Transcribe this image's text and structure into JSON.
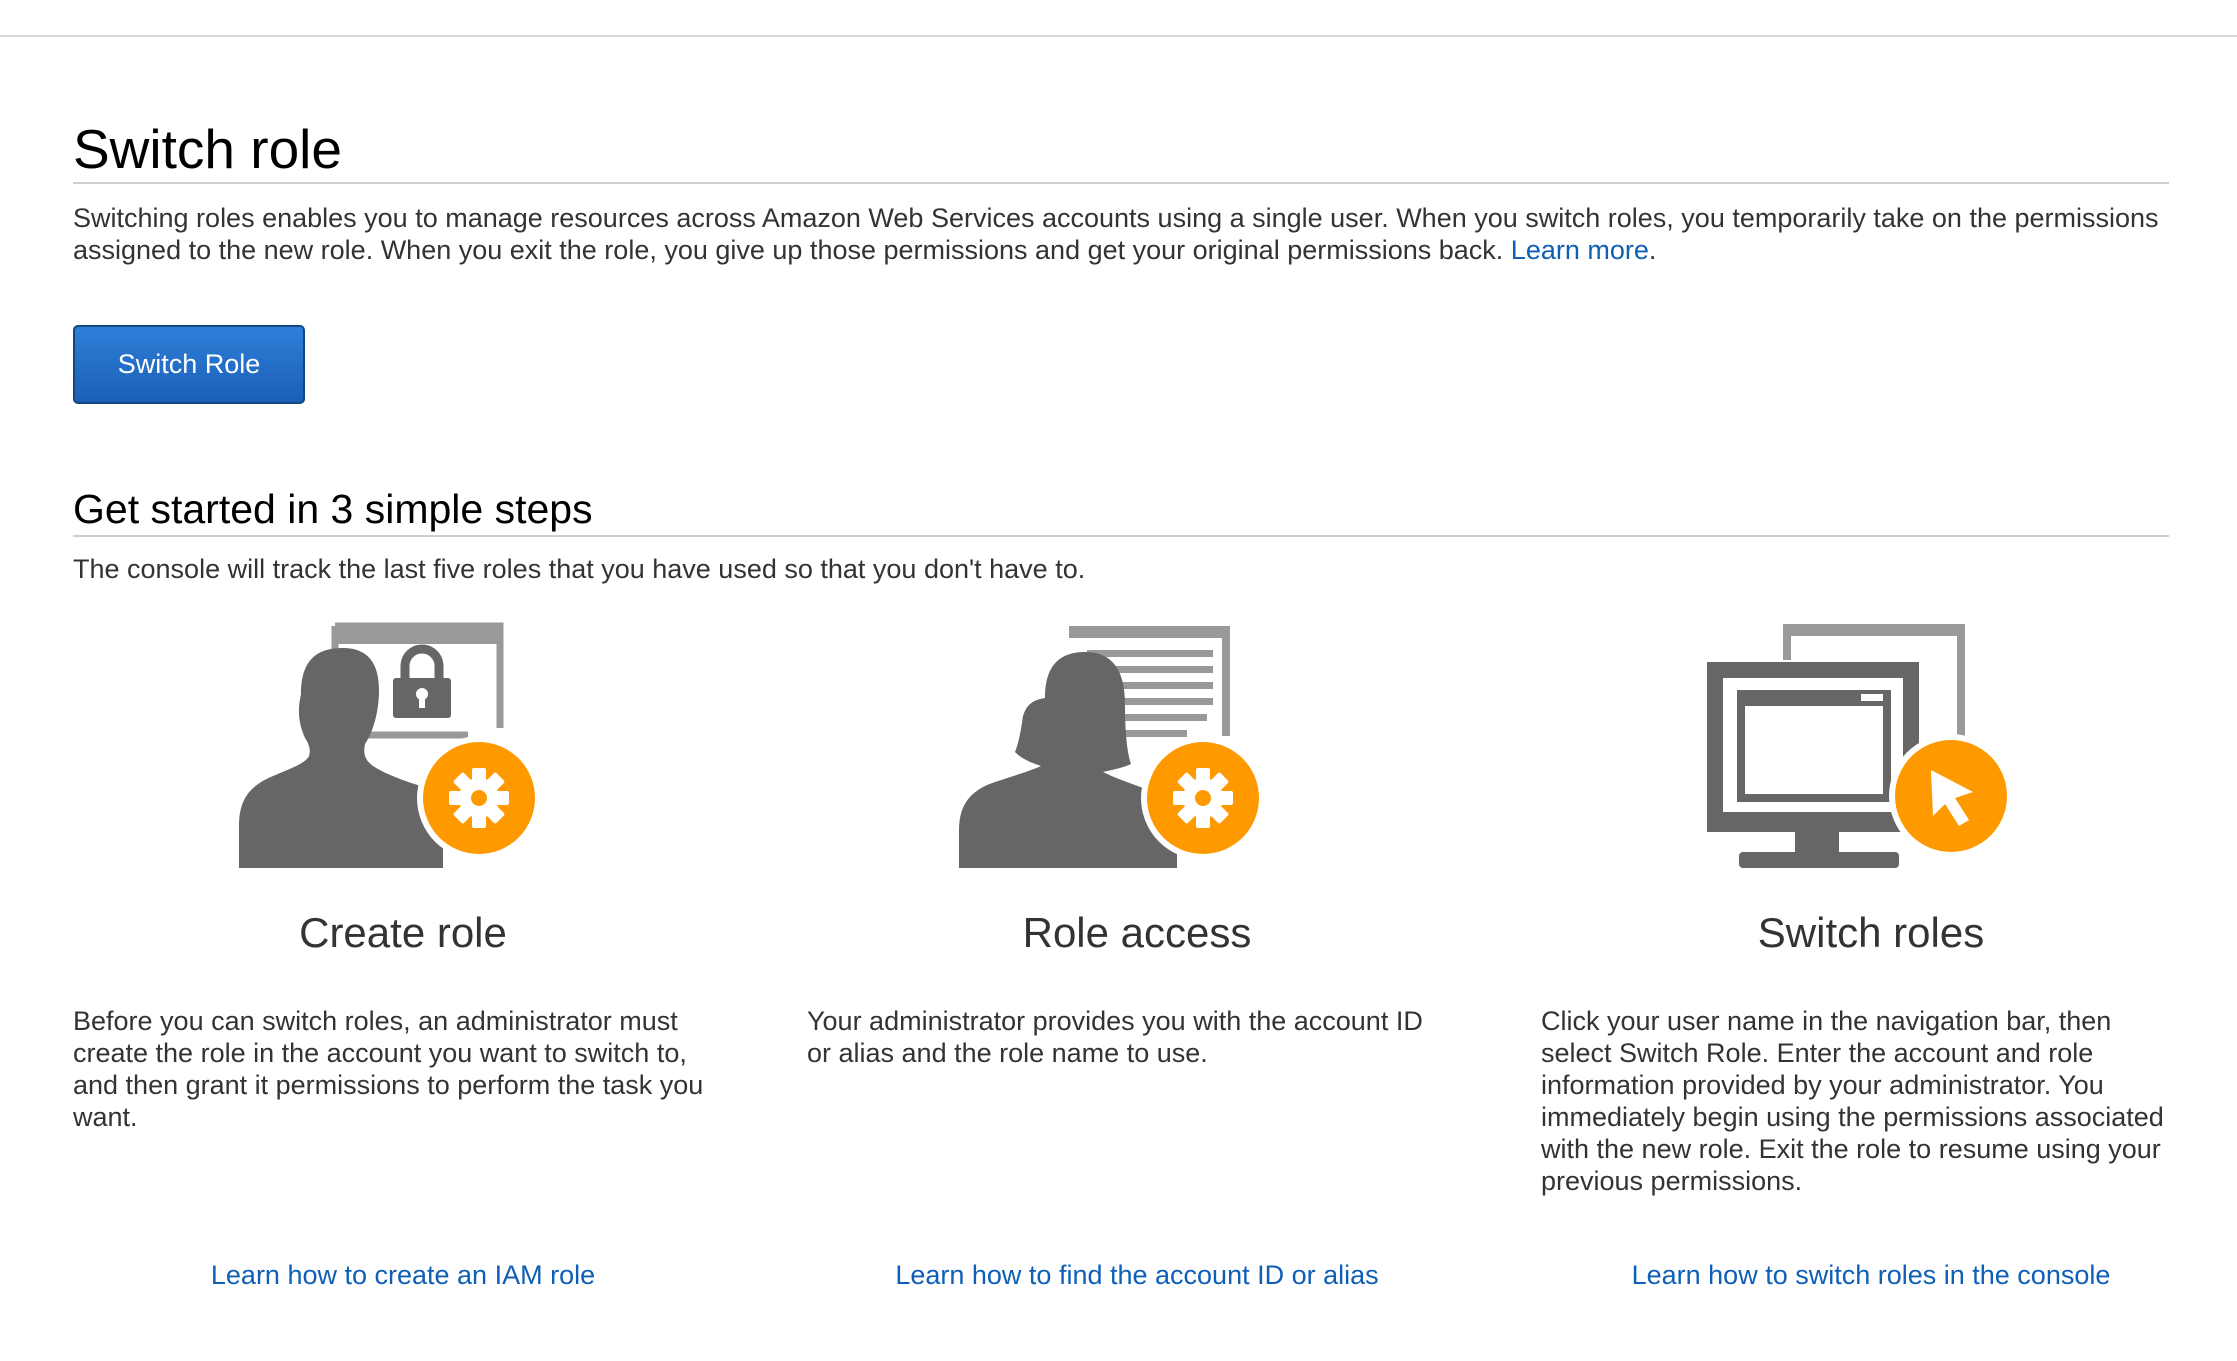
{
  "page": {
    "title": "Switch role",
    "intro_text": "Switching roles enables you to manage resources across Amazon Web Services accounts using a single user. When you switch roles, you temporarily take on the permissions assigned to the new role. When you exit the role, you give up those permissions and get your original permissions back.",
    "learn_more_label": "Learn more",
    "switch_role_button": "Switch Role"
  },
  "steps_section": {
    "title": "Get started in 3 simple steps",
    "subtitle": "The console will track the last five roles that you have used so that you don't have to.",
    "steps": [
      {
        "icon": "user-with-lock-gear-icon",
        "title": "Create role",
        "description": "Before you can switch roles, an administrator must create the role in the account you want to switch to, and then grant it permissions to perform the task you want.",
        "link": "Learn how to create an IAM role"
      },
      {
        "icon": "user-with-document-gear-icon",
        "title": "Role access",
        "description": "Your administrator provides you with the account ID or alias and the role name to use.",
        "link": "Learn how to find the account ID or alias"
      },
      {
        "icon": "monitor-with-cursor-icon",
        "title": "Switch roles",
        "description": "Click your user name in the navigation bar, then select Switch Role. Enter the account and role information provided by your administrator. You immediately begin using the permissions associated with the new role. Exit the role to resume using your previous permissions.",
        "link": "Learn how to switch roles in the console"
      }
    ]
  },
  "colors": {
    "icon_gray": "#666666",
    "icon_light_gray": "#999999",
    "accent_orange": "#ff9900",
    "link_blue": "#0e5fb5",
    "button_blue": "#1f6ac4"
  }
}
